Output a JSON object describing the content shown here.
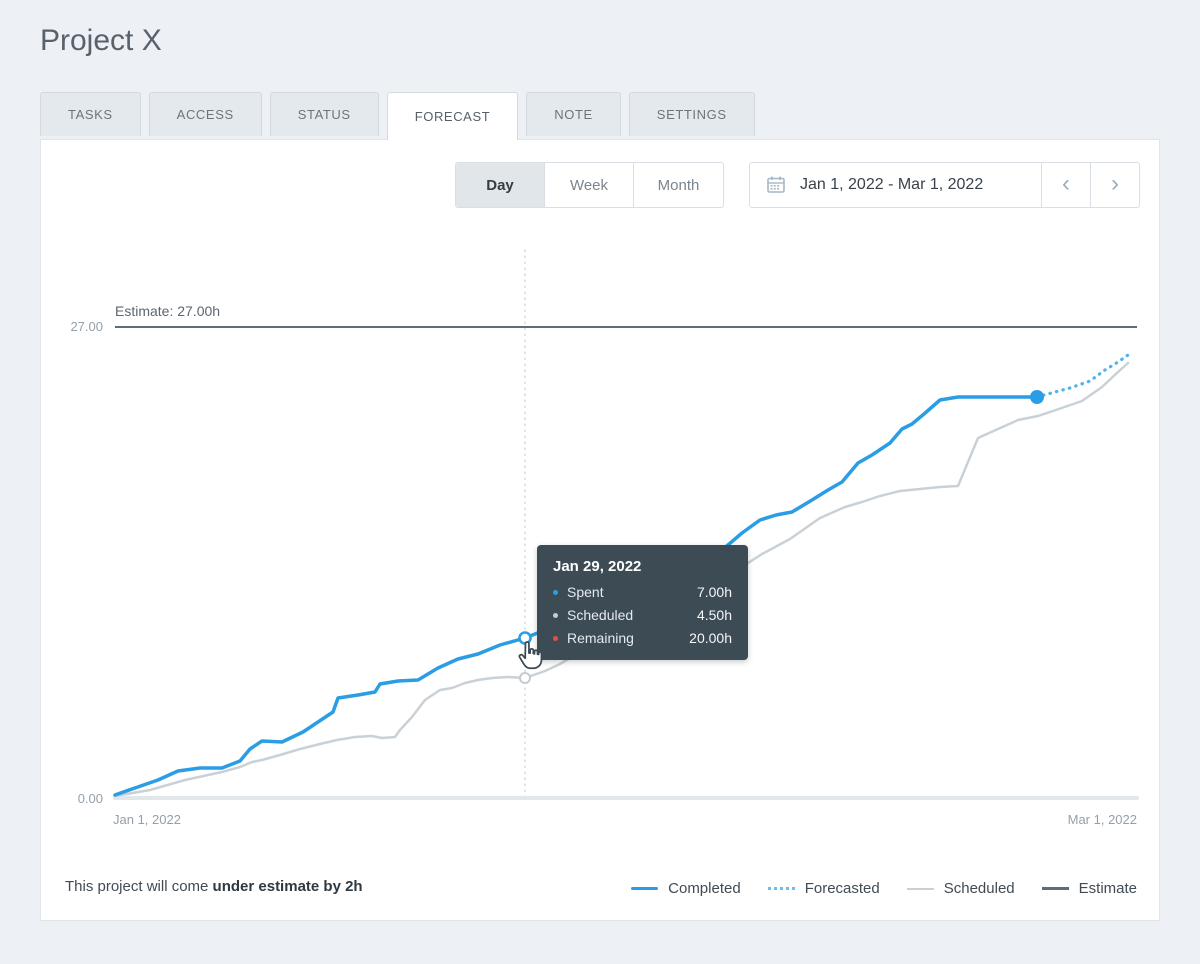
{
  "header": {
    "title": "Project X"
  },
  "tabs": {
    "items": [
      {
        "label": "TASKS"
      },
      {
        "label": "ACCESS"
      },
      {
        "label": "STATUS"
      },
      {
        "label": "FORECAST",
        "active": true
      },
      {
        "label": "NOTE"
      },
      {
        "label": "SETTINGS"
      }
    ]
  },
  "controls": {
    "view_toggle": {
      "options": [
        {
          "label": "Day",
          "selected": true
        },
        {
          "label": "Week"
        },
        {
          "label": "Month"
        }
      ]
    },
    "date_range": {
      "value": "Jan 1, 2022 - Mar 1, 2022",
      "prev_icon": "‹",
      "next_icon": "›"
    }
  },
  "chart": {
    "estimate_label": "Estimate: 27.00h",
    "y_tick_top": "27.00",
    "y_tick_bottom": "0.00",
    "x_label_left": "Jan 1, 2022",
    "x_label_right": "Mar 1, 2022"
  },
  "tooltip": {
    "title": "Jan 29, 2022",
    "rows": [
      {
        "label": "Spent",
        "value": "7.00h"
      },
      {
        "label": "Scheduled",
        "value": "4.50h"
      },
      {
        "label": "Remaining",
        "value": "20.00h"
      }
    ]
  },
  "footer": {
    "prefix": "This project will come ",
    "bold": "under estimate by 2h"
  },
  "legend": {
    "items": [
      {
        "label": "Completed"
      },
      {
        "label": "Forecasted"
      },
      {
        "label": "Scheduled"
      },
      {
        "label": "Estimate"
      }
    ]
  },
  "colors": {
    "accent_blue": "#2b9de4",
    "forecast_blue": "#6fbdee",
    "scheduled_gray": "#c9d1d7",
    "estimate_slate": "#5d6e7b",
    "remaining_red": "#de5149",
    "tooltip_bg": "#3d4b55",
    "page_bg": "#edf1f5"
  },
  "chart_data": {
    "type": "line",
    "title": "Project forecast (cumulative hours)",
    "x_range": [
      "Jan 1, 2022",
      "Mar 1, 2022"
    ],
    "ylim": [
      0,
      27
    ],
    "y_ticks": [
      "0.00",
      "27.00"
    ],
    "estimate_hours": 27,
    "estimate_annotation": "Estimate: 27.00h",
    "hover_point": {
      "date": "Jan 29, 2022",
      "spent_h": 7.0,
      "scheduled_h": 4.5,
      "remaining_h": 20.0
    },
    "final_readings_estimated": {
      "completed_h": 23,
      "forecasted_h": 25,
      "scheduled_h": 25,
      "estimate_h": 27
    },
    "forecast_conclusion": "under estimate by 2h",
    "series": [
      {
        "name": "Completed",
        "style": "solid",
        "color": "#2b9de4"
      },
      {
        "name": "Forecasted",
        "style": "dotted",
        "color": "#6fbdee"
      },
      {
        "name": "Scheduled",
        "style": "solid",
        "color": "#c9d1d7"
      },
      {
        "name": "Estimate",
        "style": "solid",
        "color": "#5d6e7b"
      }
    ],
    "pixel_paths": {
      "completed": "115,795 132,789 158,780 178,771 200,768 222,768 240,761 250,749 262,741 282,742 303,732 318,722 333,712 338,698 358,695 375,692 380,684 398,681 418,680 438,668 458,659 478,654 500,645 525,638 545,630 560,627 577,619 592,612 610,606 622,596 640,590 655,588 672,580 690,570 710,558 728,545 742,533 760,520 776,515 792,512 812,500 828,490 842,482 858,463 872,455 890,443 902,429 912,424 924,414 940,400 958,397 1037,397",
      "forecasted": "1037,397 1055,392 1070,388 1090,381 1105,370 1118,362 1128,355",
      "scheduled": "115,796 150,790 185,780 222,772 240,767 252,762 262,760 280,755 300,749 320,744 337,740 355,737 372,736 382,738 395,737 400,730 412,717 425,700 440,690 452,688 465,683 478,680 492,678 508,677 525,678 545,671 560,664 580,652 600,640 620,628 640,617 660,607 680,597 700,587 715,580 730,572 748,563 762,554 790,539 820,518 845,507 862,502 880,496 900,491 920,489 940,487 958,486 968,462 978,438 998,429 1018,420 1038,416 1053,411 1082,401 1102,387 1118,372 1128,363",
      "estimate_line": "115,327 1137,327",
      "baseline": "115,798 1137,798",
      "guideline": "525,250 525,797",
      "markers": {
        "hover_completed": {
          "x": "525",
          "y": "638"
        },
        "hover_scheduled": {
          "x": "525",
          "y": "678"
        },
        "last_completed": {
          "x": "1037",
          "y": "397"
        }
      }
    }
  }
}
